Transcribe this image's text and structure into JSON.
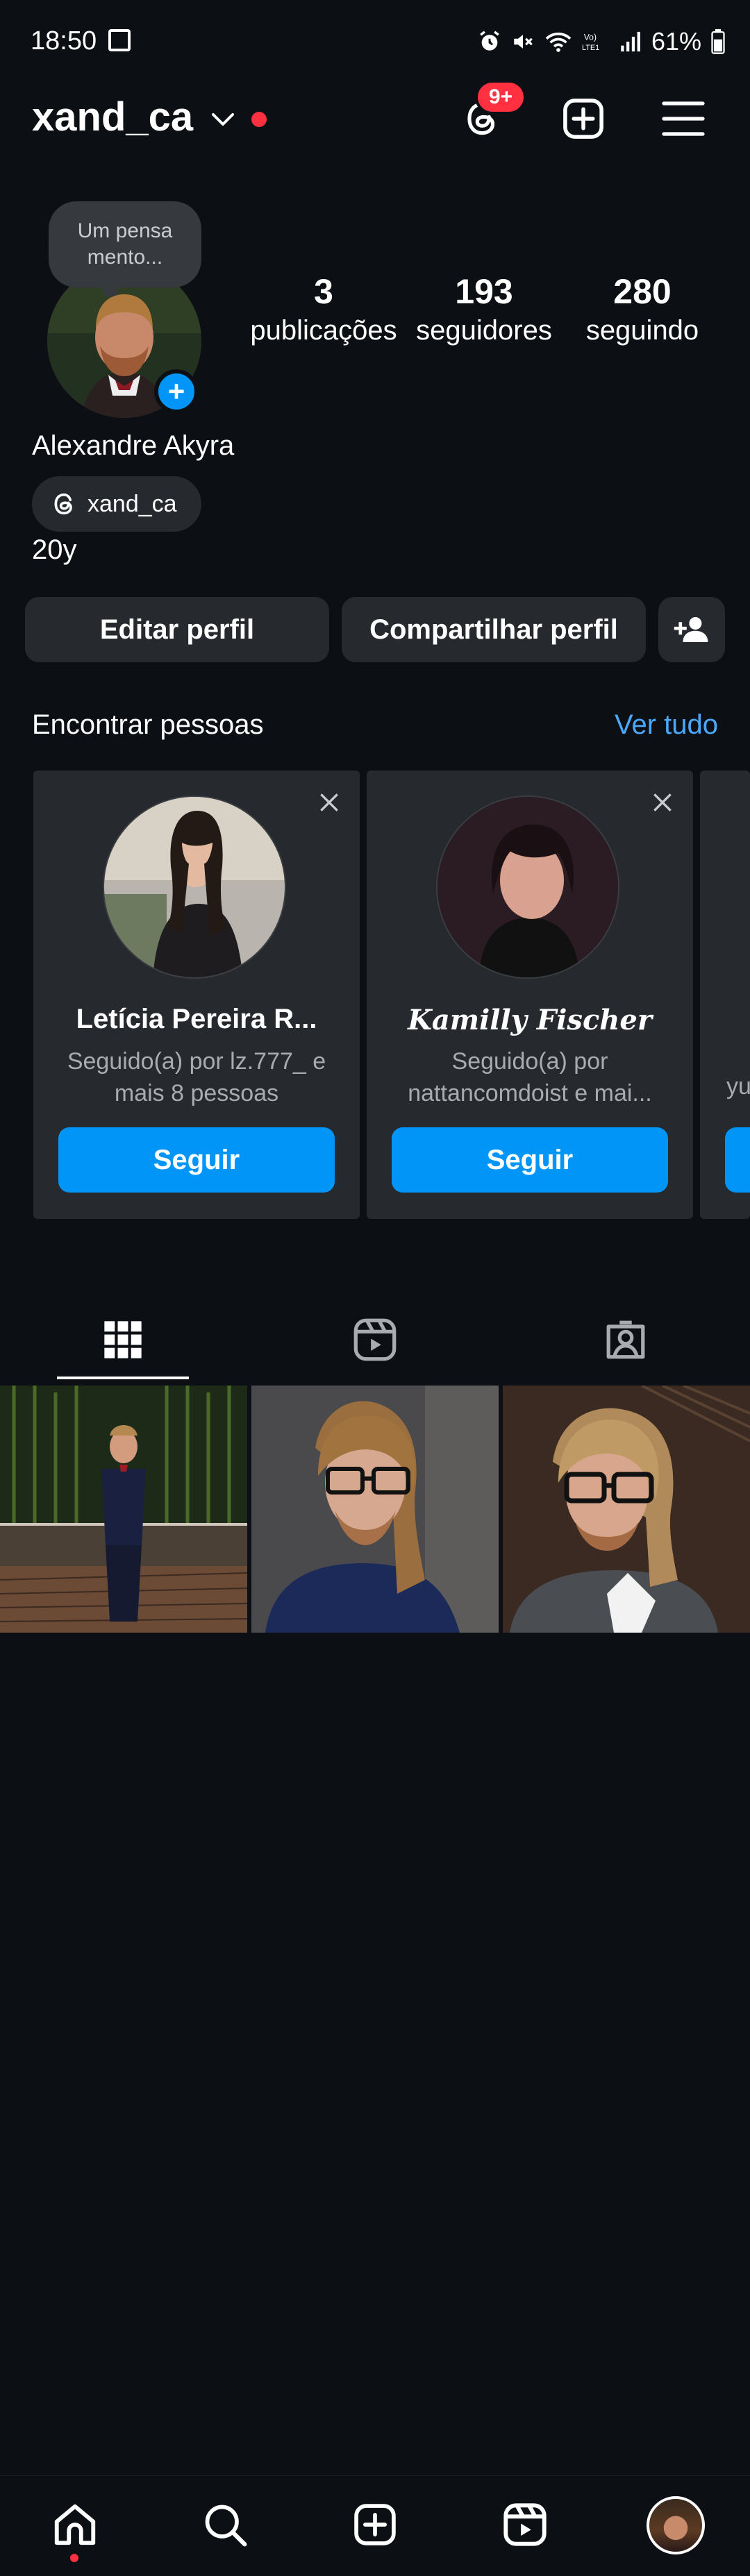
{
  "status_bar": {
    "time": "18:50",
    "battery": "61%",
    "icons": [
      "image-icon",
      "alarm-icon",
      "mute-icon",
      "wifi-icon",
      "volte-icon",
      "signal-icon",
      "battery-icon"
    ]
  },
  "header": {
    "username": "xand_ca",
    "notification_badge": "9+",
    "icons": [
      "threads-icon",
      "create-icon",
      "menu-icon"
    ]
  },
  "profile": {
    "note": "Um pensa mento...",
    "full_name": "Alexandre Akyra",
    "threads_handle": "xand_ca",
    "bio": "20y",
    "stats": [
      {
        "value": "3",
        "label": "publicações"
      },
      {
        "value": "193",
        "label": "seguidores"
      },
      {
        "value": "280",
        "label": "seguindo"
      }
    ]
  },
  "actions": {
    "edit_profile": "Editar perfil",
    "share_profile": "Compartilhar perfil"
  },
  "suggestions": {
    "title": "Encontrar pessoas",
    "see_all": "Ver tudo",
    "cards": [
      {
        "name": "Letícia Pereira R...",
        "subtitle": "Seguido(a) por lz.777_ e mais 8 pessoas",
        "button": "Seguir"
      },
      {
        "name": "𝑲𝒂𝒎𝒊𝒍𝒍𝒚 𝑭𝒊𝒔𝒄𝒉𝒆𝒓",
        "subtitle": "Seguido(a) por nattancomdoist e mai...",
        "button": "Seguir"
      },
      {
        "name": "",
        "subtitle": "yu",
        "button": ""
      }
    ]
  },
  "tabs": [
    "grid-icon",
    "reels-icon",
    "tagged-icon"
  ],
  "posts_count": 3,
  "bottom_nav": [
    "home-icon",
    "search-icon",
    "create-icon",
    "reels-icon",
    "profile-avatar"
  ],
  "colors": {
    "background": "#0c1014",
    "surface": "#26292e",
    "accent": "#0095f6",
    "link": "#4aa8ff",
    "badge": "#ff3040"
  }
}
